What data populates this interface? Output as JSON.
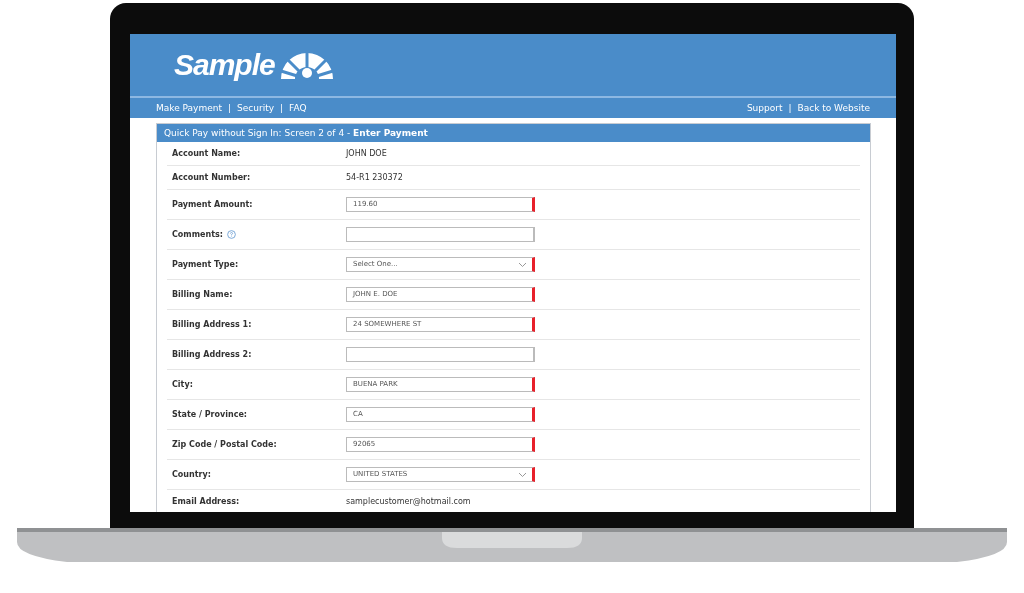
{
  "logo": {
    "text": "Sample"
  },
  "nav_left": [
    {
      "label": "Make Payment"
    },
    {
      "label": "Security"
    },
    {
      "label": "FAQ"
    }
  ],
  "nav_right": [
    {
      "label": "Support"
    },
    {
      "label": "Back to Website"
    }
  ],
  "nav_separator": "|",
  "panel": {
    "title": "Quick Pay without Sign In: Screen 2 of 4 - **Enter Payment**",
    "rows": [
      {
        "label": "Account Name:",
        "kind": "text",
        "value": "JOHN DOE"
      },
      {
        "label": "Account Number:",
        "kind": "text",
        "value": "54-R1 230372"
      },
      {
        "label": "Payment Amount:",
        "kind": "input",
        "value": "119.60",
        "required": true
      },
      {
        "label": "Comments:",
        "kind": "input",
        "help": true,
        "required": false
      },
      {
        "label": "Payment Type:",
        "kind": "select",
        "value": "Select One...",
        "required": true
      },
      {
        "label": "Billing Name:",
        "kind": "input",
        "value": "JOHN E. DOE",
        "required": true
      },
      {
        "label": "Billing Address 1:",
        "kind": "input",
        "value": "24 SOMEWHERE ST",
        "required": true
      },
      {
        "label": "Billing Address 2:",
        "kind": "input",
        "required": false
      },
      {
        "label": "City:",
        "kind": "input",
        "value": "BUENA PARK",
        "required": true
      },
      {
        "label": "State / Province:",
        "kind": "input",
        "value": "CA",
        "required": true
      },
      {
        "label": "Zip Code / Postal Code:",
        "kind": "input",
        "value": "92065",
        "required": true
      },
      {
        "label": "Country:",
        "kind": "select",
        "value": "UNITED STATES",
        "required": true
      },
      {
        "label": "Email Address:",
        "kind": "text",
        "value": "samplecustomer@hotmail.com"
      }
    ]
  }
}
